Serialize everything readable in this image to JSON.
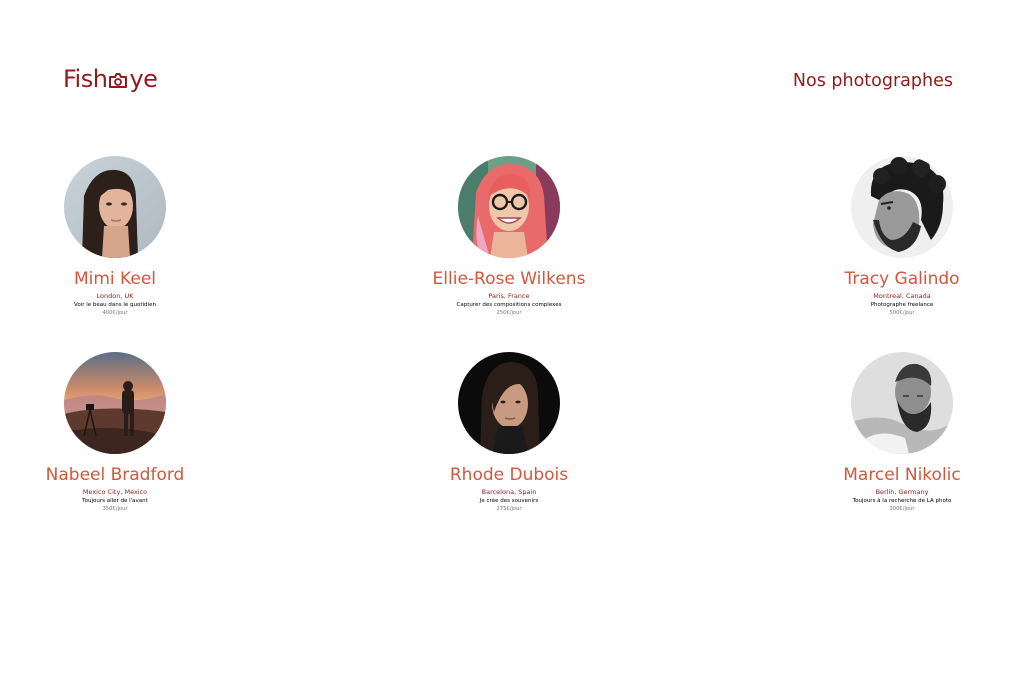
{
  "header": {
    "logo_text_before": "Fish",
    "logo_icon": "camera-icon",
    "logo_text_after": "ye",
    "heading": "Nos photographes"
  },
  "colors": {
    "brand": "#901C1C",
    "name": "#D3573C",
    "price": "#757575"
  },
  "photographers": [
    {
      "name": "Mimi Keel",
      "location": "London, UK",
      "tagline": "Voir le beau dans le quotidien",
      "price": "400€/jour"
    },
    {
      "name": "Ellie-Rose Wilkens",
      "location": "Paris, France",
      "tagline": "Capturer des compositions complexes",
      "price": "250€/jour"
    },
    {
      "name": "Tracy Galindo",
      "location": "Montreal, Canada",
      "tagline": "Photographe freelance",
      "price": "500€/jour"
    },
    {
      "name": "Nabeel Bradford",
      "location": "Mexico City, Mexico",
      "tagline": "Toujours aller de l'avant",
      "price": "350€/jour"
    },
    {
      "name": "Rhode Dubois",
      "location": "Barcelona, Spain",
      "tagline": "Je crée des souvenirs",
      "price": "275€/jour"
    },
    {
      "name": "Marcel Nikolic",
      "location": "Berlin, Germany",
      "tagline": "Toujours à la recherche de LA photo",
      "price": "300€/jour"
    }
  ]
}
